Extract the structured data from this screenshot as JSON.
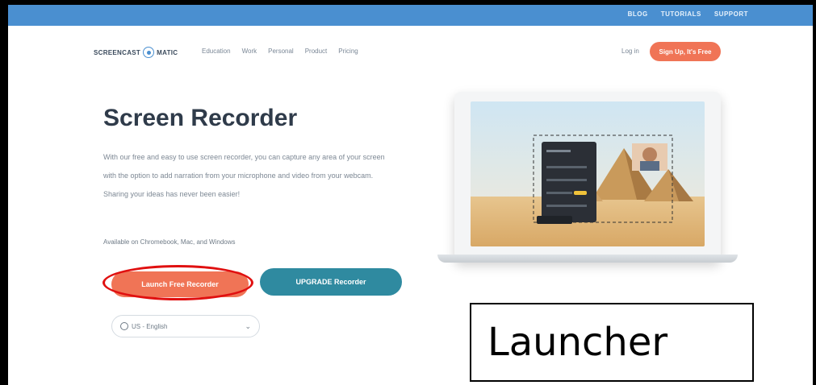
{
  "topbar": {
    "links": [
      "BLOG",
      "TUTORIALS",
      "SUPPORT"
    ]
  },
  "nav": {
    "logo_left": "SCREENCAST",
    "logo_right": "MATIC",
    "menu": [
      "Education",
      "Work",
      "Personal",
      "Product",
      "Pricing"
    ],
    "login": "Log in",
    "signup": "Sign Up, It's Free"
  },
  "hero": {
    "title": "Screen Recorder",
    "description": "With our free and easy to use screen recorder, you can capture any area of your screen with the option to add narration from your microphone and video from your webcam. Sharing your ideas has never been easier!",
    "availability": "Available on Chromebook, Mac, and Windows"
  },
  "buttons": {
    "launch": "Launch Free Recorder",
    "upgrade": "UPGRADE Recorder"
  },
  "language": {
    "selected": "US - English"
  },
  "caption": "Launcher",
  "colors": {
    "brand_blue": "#4a8fd0",
    "cta_orange": "#f07456",
    "upgrade_teal": "#2f8aa0",
    "highlight_red": "#e01010"
  }
}
